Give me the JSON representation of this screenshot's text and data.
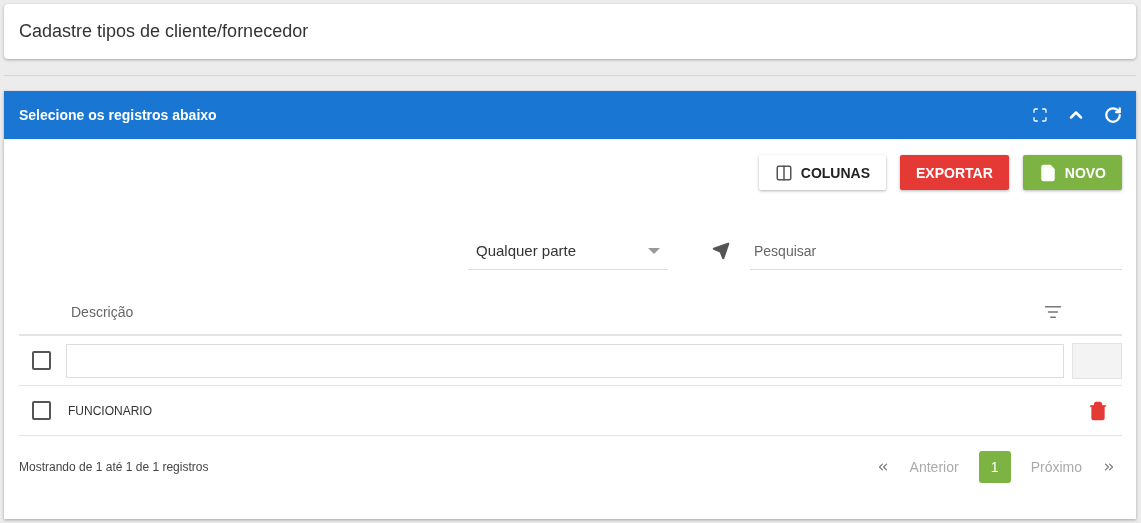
{
  "page_title": "Cadastre tipos de cliente/fornecedor",
  "panel": {
    "title": "Selecione os registros abaixo"
  },
  "toolbar": [
    {
      "kind": "columns",
      "label": "COLUNAS"
    },
    {
      "kind": "export",
      "label": "EXPORTAR"
    },
    {
      "kind": "new",
      "label": "NOVO"
    }
  ],
  "search": {
    "mode": "Qualquer parte",
    "placeholder": "Pesquisar"
  },
  "table": {
    "columns": [
      "Descrição"
    ],
    "filter_row": {
      "checked": false
    },
    "rows": [
      {
        "description": "FUNCIONARIO",
        "checked": false
      }
    ]
  },
  "footer": {
    "summary": "Mostrando de 1 até 1 de 1 registros",
    "previous": "Anterior",
    "next": "Próximo",
    "pages": [
      {
        "label": "1",
        "selected": true
      }
    ]
  }
}
